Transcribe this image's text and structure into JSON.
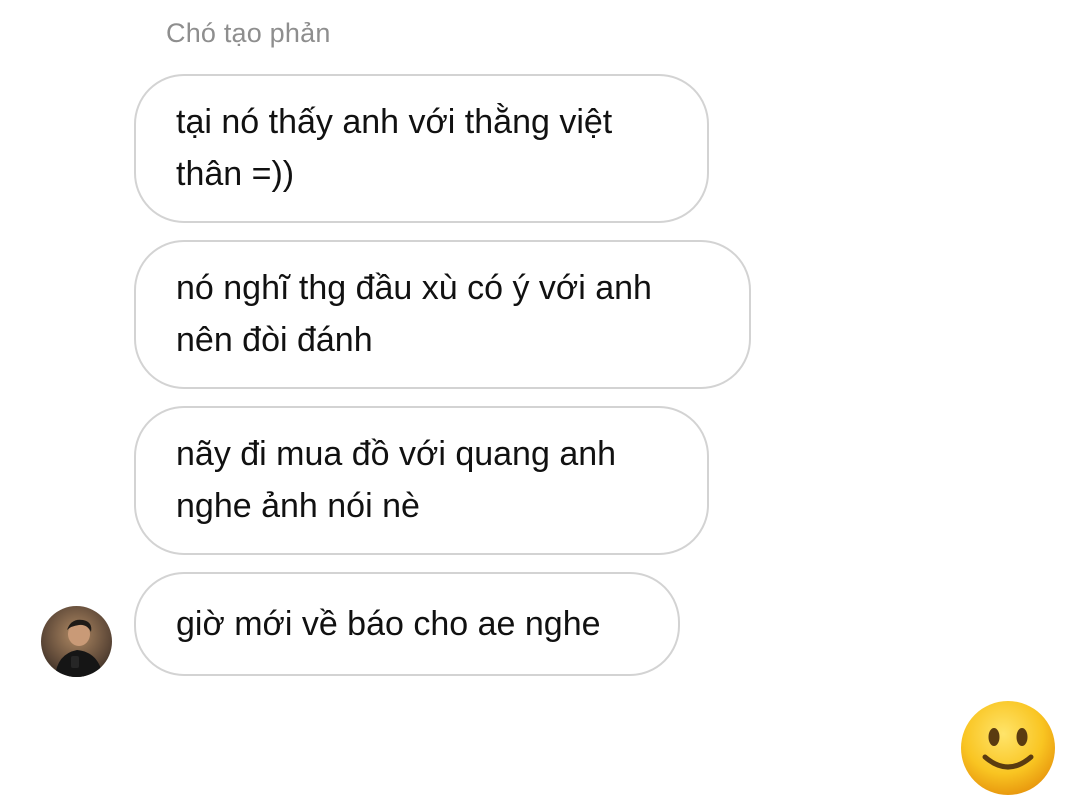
{
  "conversation": {
    "sender_name": "Chó tạo phản",
    "messages": [
      {
        "text": "tại nó thấy anh với thằng việt\nthân =))"
      },
      {
        "text": "nó nghĩ thg đầu xù có ý với anh\nnên đòi đánh"
      },
      {
        "text": "nãy đi mua đồ với quang anh\nnghe ảnh nói nè"
      },
      {
        "text": "giờ mới về báo cho ae nghe"
      }
    ]
  },
  "icons": {
    "avatar": "avatar-photo",
    "emoji": "slightly-smiling-face-icon"
  },
  "colors": {
    "bubble_border": "#d3d3d3",
    "sender_name": "#8e8e8e",
    "emoji_face": "#f7c21a"
  }
}
